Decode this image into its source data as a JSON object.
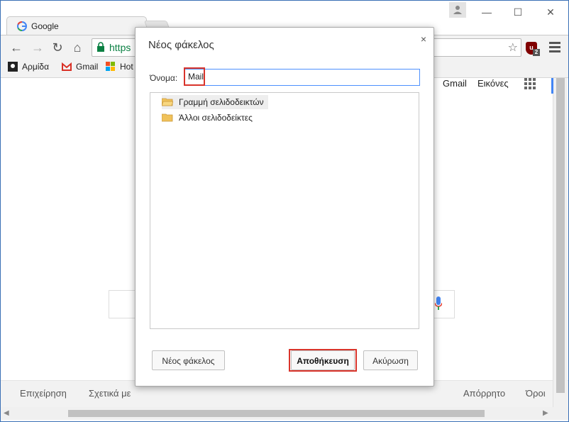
{
  "browser": {
    "tab_title": "Google",
    "url_fragment": "https",
    "bookmarks": [
      "Αρμίδα",
      "Gmail",
      "Hot"
    ]
  },
  "page": {
    "top_links": [
      "Gmail",
      "Εικόνες"
    ],
    "footer_left": [
      "Επιχείρηση",
      "Σχετικά με"
    ],
    "footer_right": [
      "Απόρρητο",
      "Όροι"
    ]
  },
  "dialog": {
    "title": "Νέος φάκελος",
    "close_glyph": "×",
    "name_label": "Όνομα:",
    "name_value": "Mail",
    "folders": [
      "Γραμμή σελιδοδεικτών",
      "Άλλοι σελιδοδείκτες"
    ],
    "new_folder_button": "Νέος φάκελος",
    "save_button": "Αποθήκευση",
    "cancel_button": "Ακύρωση"
  },
  "colors": {
    "highlight": "#d9342b",
    "focus_border": "#4d90fe",
    "secure_green": "#0b8043"
  },
  "icons": [
    "google-g-icon",
    "lock-icon",
    "star-icon",
    "ublock-icon",
    "menu-icon",
    "back-icon",
    "forward-icon",
    "reload-icon",
    "home-icon",
    "folder-icon",
    "apps-grid-icon",
    "mic-icon",
    "user-icon",
    "minimize-icon",
    "maximize-icon",
    "close-icon"
  ]
}
